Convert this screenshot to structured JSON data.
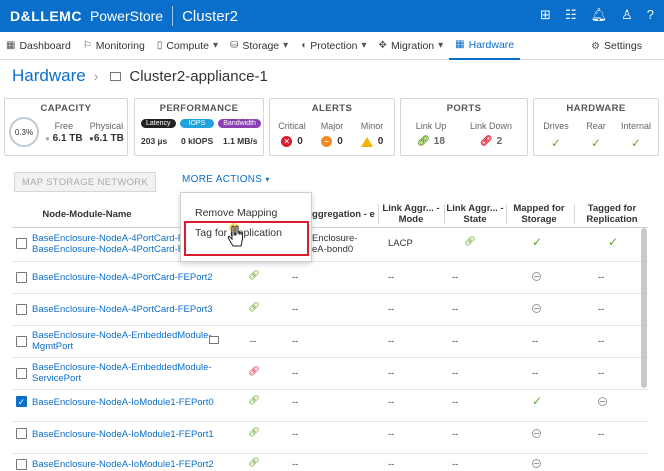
{
  "topbar": {
    "brand": "D&LLEMC",
    "product": "PowerStore",
    "cluster": "Cluster2",
    "icons": [
      "grid-icon",
      "tasks-icon",
      "bell-icon",
      "user-icon",
      "help-icon"
    ]
  },
  "nav": {
    "items": [
      {
        "label": "Dashboard",
        "icon": "dashboard-icon"
      },
      {
        "label": "Monitoring",
        "icon": "flag-icon"
      },
      {
        "label": "Compute",
        "icon": "compute-icon"
      },
      {
        "label": "Storage",
        "icon": "storage-icon"
      },
      {
        "label": "Protection",
        "icon": "shield-icon"
      },
      {
        "label": "Migration",
        "icon": "migration-icon"
      },
      {
        "label": "Hardware",
        "icon": "hardware-icon"
      }
    ],
    "settings": "Settings"
  },
  "breadcrumb": {
    "root": "Hardware",
    "current": "Cluster2-appliance-1"
  },
  "capacity": {
    "title": "CAPACITY",
    "percent": "0.3%",
    "free_label": "Free",
    "free_value": "6.1 TB",
    "physical_label": "Physical",
    "physical_value": "6.1 TB"
  },
  "performance": {
    "title": "PERFORMANCE",
    "latency_label": "Latency",
    "iops_label": "IOPS",
    "bandwidth_label": "Bandwidth",
    "latency": "203 µs",
    "iops": "0 kIOPS",
    "bandwidth": "1.1 MB/s",
    "colors": {
      "latency": "#222222",
      "iops": "#1fa3d8",
      "bandwidth": "#8b3fb3"
    }
  },
  "alerts": {
    "title": "ALERTS",
    "critical_label": "Critical",
    "critical": "0",
    "major_label": "Major",
    "major": "0",
    "minor_label": "Minor",
    "minor": "0"
  },
  "ports": {
    "title": "PORTS",
    "linkup_label": "Link Up",
    "linkup": "18",
    "linkdown_label": "Link Down",
    "linkdown": "2"
  },
  "hardware": {
    "title": "HARDWARE",
    "drives": "Drives",
    "rear": "Rear",
    "internal": "Internal"
  },
  "actions": {
    "map": "MAP STORAGE NETWORK",
    "more": "MORE ACTIONS"
  },
  "menu": {
    "items": [
      "Remove Mapping",
      "Tag for Replication"
    ]
  },
  "table": {
    "headers": [
      "Node-Module-Name",
      "Aggregation - e",
      "Link Aggr... - Mode",
      "Link Aggr... - State",
      "Mapped for Storage",
      "Tagged for Replication"
    ],
    "rows": [
      {
        "name1": "BaseEnclosure-NodeA-4PortCard-FE",
        "name2": "BaseEnclosure-NodeA-4PortCard-FE",
        "agg1": "Enclosure-",
        "agg2": "eA-bond0",
        "mode": "LACP",
        "checked": false
      },
      {
        "name1": "BaseEnclosure-NodeA-4PortCard-FEPort2",
        "agg": "--",
        "mode": "--",
        "state": "--",
        "tagged": "--",
        "checked": false
      },
      {
        "name1": "BaseEnclosure-NodeA-4PortCard-FEPort3",
        "agg": "--",
        "mode": "--",
        "state": "--",
        "tagged": "--",
        "checked": false
      },
      {
        "name1": "BaseEnclosure-NodeA-EmbeddedModule-",
        "name2": "MgmtPort",
        "link": "--",
        "agg": "--",
        "mode": "--",
        "state": "--",
        "mapped": "--",
        "tagged": "--",
        "checked": false
      },
      {
        "name1": "BaseEnclosure-NodeA-EmbeddedModule-",
        "name2": "ServicePort",
        "agg": "--",
        "mode": "--",
        "state": "--",
        "mapped": "--",
        "tagged": "--",
        "checked": false
      },
      {
        "name1": "BaseEnclosure-NodeA-IoModule1-FEPort0",
        "agg": "--",
        "mode": "--",
        "state": "--",
        "checked": true
      },
      {
        "name1": "BaseEnclosure-NodeA-IoModule1-FEPort1",
        "agg": "--",
        "mode": "--",
        "state": "--",
        "tagged": "--",
        "checked": false
      },
      {
        "name1": "BaseEnclosure-NodeA-IoModule1-FEPort2",
        "agg": "--",
        "mode": "--",
        "state": "--",
        "checked": false
      }
    ]
  },
  "colors": {
    "brand_blue": "#0a6ecb",
    "check_green": "#6aa52a",
    "highlight_red": "#d81e2c"
  }
}
